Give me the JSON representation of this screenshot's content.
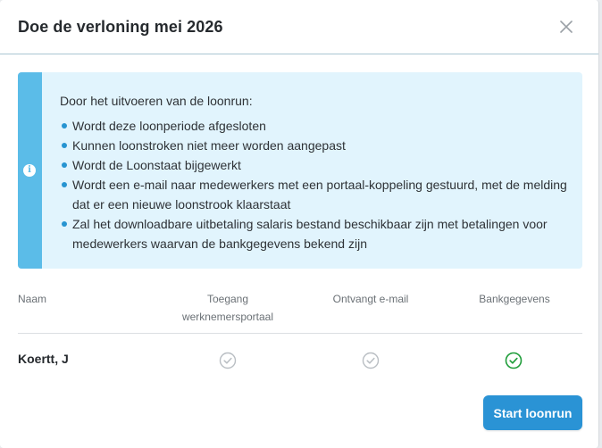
{
  "modal": {
    "title": "Doe de verloning mei 2026",
    "close_icon": "close-icon"
  },
  "info": {
    "icon": "info-icon",
    "icon_glyph": "i",
    "intro": "Door het uitvoeren van de loonrun:",
    "items": [
      "Wordt deze loonperiode afgesloten",
      "Kunnen loonstroken niet meer worden aangepast",
      "Wordt de Loonstaat bijgewerkt",
      "Wordt een e-mail naar medewerkers met een portaal-koppeling gestuurd, met de melding dat er een nieuwe loonstrook klaarstaat",
      "Zal het downloadbare uitbetaling salaris bestand beschikbaar zijn met betalingen voor medewerkers waarvan de bankgegevens bekend zijn"
    ]
  },
  "table": {
    "headers": {
      "name": "Naam",
      "portal_line1": "Toegang",
      "portal_line2": "werknemersportaal",
      "email": "Ontvangt e-mail",
      "bank": "Bankgegevens"
    },
    "rows": [
      {
        "name": "Koertt, J",
        "portal": false,
        "email": false,
        "bank": true
      }
    ]
  },
  "actions": {
    "start_label": "Start loonrun"
  },
  "colors": {
    "accent": "#2a93d5",
    "info_bg": "#e1f4fd",
    "info_stripe": "#5bbce8",
    "check_ok": "#1f9d3a",
    "check_off": "#b9bec3"
  }
}
